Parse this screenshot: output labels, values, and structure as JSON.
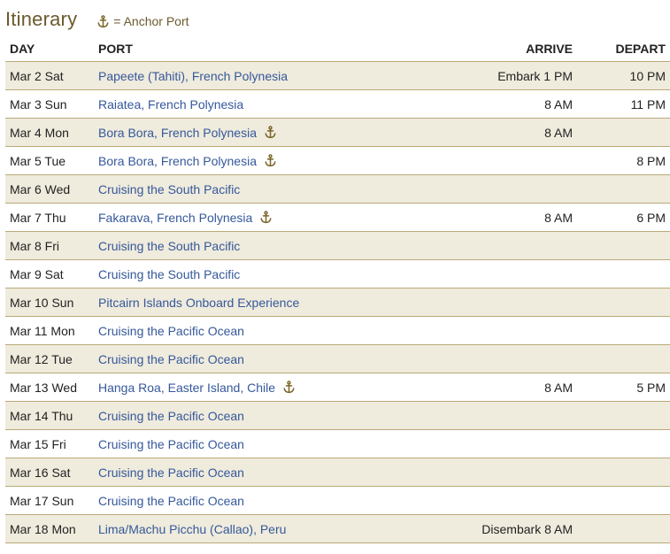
{
  "header": {
    "title": "Itinerary",
    "legend_text": "= Anchor Port",
    "legend_icon": "anchor-icon"
  },
  "colors": {
    "title": "#6b5a2d",
    "link": "#35589a",
    "row_shade": "#efebdd",
    "divider": "#b9aa78"
  },
  "table": {
    "columns": {
      "day": "DAY",
      "port": "PORT",
      "arrive": "ARRIVE",
      "depart": "DEPART"
    },
    "rows": [
      {
        "day": "Mar 2 Sat",
        "port": "Papeete (Tahiti), French Polynesia",
        "anchor": false,
        "arrive": "Embark 1 PM",
        "depart": "10 PM"
      },
      {
        "day": "Mar 3 Sun",
        "port": "Raiatea, French Polynesia",
        "anchor": false,
        "arrive": "8 AM",
        "depart": "11 PM"
      },
      {
        "day": "Mar 4 Mon",
        "port": "Bora Bora, French Polynesia",
        "anchor": true,
        "arrive": "8 AM",
        "depart": ""
      },
      {
        "day": "Mar 5 Tue",
        "port": "Bora Bora, French Polynesia",
        "anchor": true,
        "arrive": "",
        "depart": "8 PM"
      },
      {
        "day": "Mar 6 Wed",
        "port": "Cruising the South Pacific",
        "anchor": false,
        "arrive": "",
        "depart": ""
      },
      {
        "day": "Mar 7 Thu",
        "port": "Fakarava, French Polynesia",
        "anchor": true,
        "arrive": "8 AM",
        "depart": "6 PM"
      },
      {
        "day": "Mar 8 Fri",
        "port": "Cruising the South Pacific",
        "anchor": false,
        "arrive": "",
        "depart": ""
      },
      {
        "day": "Mar 9 Sat",
        "port": "Cruising the South Pacific",
        "anchor": false,
        "arrive": "",
        "depart": ""
      },
      {
        "day": "Mar 10 Sun",
        "port": "Pitcairn Islands Onboard Experience",
        "anchor": false,
        "arrive": "",
        "depart": ""
      },
      {
        "day": "Mar 11 Mon",
        "port": "Cruising the Pacific Ocean",
        "anchor": false,
        "arrive": "",
        "depart": ""
      },
      {
        "day": "Mar 12 Tue",
        "port": "Cruising the Pacific Ocean",
        "anchor": false,
        "arrive": "",
        "depart": ""
      },
      {
        "day": "Mar 13 Wed",
        "port": "Hanga Roa, Easter Island, Chile",
        "anchor": true,
        "arrive": "8 AM",
        "depart": "5 PM"
      },
      {
        "day": "Mar 14 Thu",
        "port": "Cruising the Pacific Ocean",
        "anchor": false,
        "arrive": "",
        "depart": ""
      },
      {
        "day": "Mar 15 Fri",
        "port": "Cruising the Pacific Ocean",
        "anchor": false,
        "arrive": "",
        "depart": ""
      },
      {
        "day": "Mar 16 Sat",
        "port": "Cruising the Pacific Ocean",
        "anchor": false,
        "arrive": "",
        "depart": ""
      },
      {
        "day": "Mar 17 Sun",
        "port": "Cruising the Pacific Ocean",
        "anchor": false,
        "arrive": "",
        "depart": ""
      },
      {
        "day": "Mar 18 Mon",
        "port": "Lima/Machu Picchu (Callao), Peru",
        "anchor": false,
        "arrive": "Disembark 8 AM",
        "depart": ""
      }
    ]
  }
}
